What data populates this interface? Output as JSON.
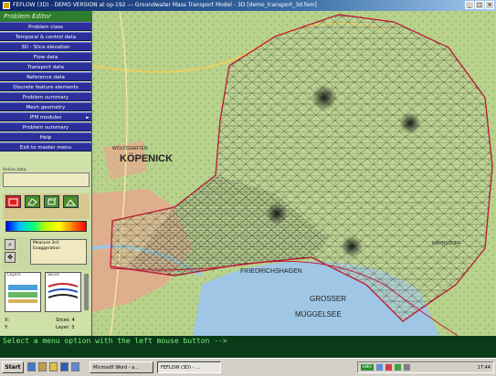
{
  "window": {
    "title": "FEFLOW (3D) - DEMO VERSION at op-192 --- Groundwater Mass Transport Model - 3D [demo_transport_3d.fem]"
  },
  "editor": {
    "title": "Problem Editor",
    "menu": [
      {
        "label": "Problem class"
      },
      {
        "label": "Temporal & control data"
      },
      {
        "label": "3D - Slice elevation"
      },
      {
        "label": "Flow data"
      },
      {
        "label": "Transport data"
      },
      {
        "label": "Reference data"
      },
      {
        "label": "Discrete feature elements"
      },
      {
        "label": "Problem summary"
      },
      {
        "label": "Mesh geometry"
      },
      {
        "label": "IFM modules",
        "arrow": "►"
      },
      {
        "label": "Problem summary"
      },
      {
        "label": "Help"
      },
      {
        "label": "Exit to master menu"
      }
    ],
    "input_label": "Active data",
    "measure": {
      "line1": "Measure 3rd",
      "line2": "Exaggeration"
    },
    "views": {
      "left": "Layers",
      "right": "Slices"
    },
    "readout": {
      "x_label": "X:",
      "y_label": "Y:",
      "slices": "Slices: 4",
      "layers": "Layer: 3"
    }
  },
  "map": {
    "labels": {
      "kopenick": "KÖPENICK",
      "wolfsgarten": "WOLFSGARTEN",
      "friedrichshagen": "FRIEDRICHSHAGEN",
      "grosser": "GROSSER",
      "mueggelsee": "MÜGGELSEE",
      "rahnsdorf": "RAHNSDORF"
    },
    "colors": {
      "forest": "#b8d28c",
      "mesh": "#2a2a2a",
      "boundary": "#c0203c",
      "lake": "#9fc6e4",
      "urban": "#e9a58c"
    }
  },
  "command_line": {
    "text": "Select a menu option with the left mouse button -->"
  },
  "taskbar": {
    "start": "Start",
    "tasks": [
      {
        "label": "Microsoft Word - a..."
      },
      {
        "label": "FEFLOW (3D) - ..."
      }
    ],
    "tray_chip": "ENG",
    "clock": "17:44"
  }
}
